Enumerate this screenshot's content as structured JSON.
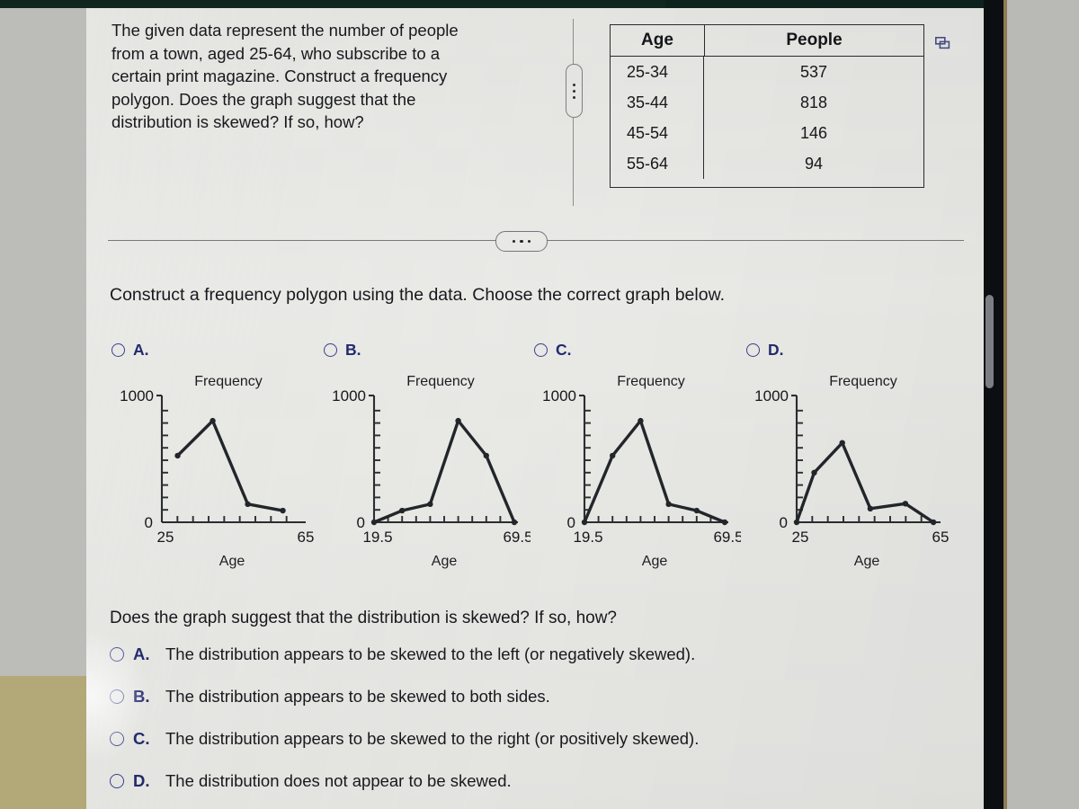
{
  "nav": {
    "back_icon": "back-to-start-icon",
    "copy_icon": "copy-icon",
    "divider_handle_icon": "vertical-more-options-icon",
    "section_expand_icon": "horizontal-more-options-icon"
  },
  "problem": {
    "statement": "The given data represent the number of people from a town, aged 25-64, who subscribe to a certain print magazine. Construct a frequency polygon. Does the graph suggest that the distribution is skewed? If so, how?"
  },
  "table": {
    "headers": [
      "Age",
      "People"
    ],
    "rows": [
      {
        "age": "25-34",
        "people": "537"
      },
      {
        "age": "35-44",
        "people": "818"
      },
      {
        "age": "45-54",
        "people": "146"
      },
      {
        "age": "55-64",
        "people": "94"
      }
    ]
  },
  "instruction": "Construct a frequency polygon using the data. Choose the correct graph below.",
  "graph_options": [
    {
      "letter": "A.",
      "selected": false
    },
    {
      "letter": "B.",
      "selected": false
    },
    {
      "letter": "C.",
      "selected": false
    },
    {
      "letter": "D.",
      "selected": false
    }
  ],
  "question2": {
    "prompt": "Does the graph suggest that the distribution is skewed? If so, how?",
    "options": [
      {
        "letter": "A.",
        "text": "The distribution appears to be skewed to the left (or negatively skewed).",
        "selected": false
      },
      {
        "letter": "B.",
        "text": "The distribution appears to be skewed to both sides.",
        "selected": false
      },
      {
        "letter": "C.",
        "text": "The distribution appears to be skewed to the right (or positively skewed).",
        "selected": false
      },
      {
        "letter": "D.",
        "text": "The distribution does not appear to be skewed.",
        "selected": false
      }
    ]
  },
  "colors": {
    "page_background": "#e9e9e6",
    "text": "#17191c",
    "radio_blue": "#3b4090",
    "letter_blue": "#222a6e",
    "plot_line": "#22262a",
    "axis": "#2a2e31"
  },
  "chart_data": [
    {
      "id": "A",
      "type": "line",
      "title": "",
      "xlabel": "Age",
      "ylabel": "Frequency",
      "ylim": [
        0,
        1000
      ],
      "ytick_labels": [
        "0",
        "1000"
      ],
      "xlim": [
        25,
        65
      ],
      "xtick_labels": [
        "25",
        "65"
      ],
      "x_minor_ticks": 8,
      "y_minor_ticks": 9,
      "grid": false,
      "x": [
        29.5,
        39.5,
        49.5,
        59.5
      ],
      "values": [
        537,
        818,
        146,
        94
      ]
    },
    {
      "id": "B",
      "type": "line",
      "title": "",
      "xlabel": "Age",
      "ylabel": "Frequency",
      "ylim": [
        0,
        1000
      ],
      "ytick_labels": [
        "0",
        "1000"
      ],
      "xlim": [
        19.5,
        69.5
      ],
      "xtick_labels": [
        "19.5",
        "69.5"
      ],
      "x_minor_ticks": 9,
      "y_minor_ticks": 9,
      "grid": false,
      "x": [
        19.5,
        29.5,
        39.5,
        49.5,
        59.5,
        69.5
      ],
      "values": [
        0,
        94,
        146,
        818,
        537,
        0
      ]
    },
    {
      "id": "C",
      "type": "line",
      "title": "",
      "xlabel": "Age",
      "ylabel": "Frequency",
      "ylim": [
        0,
        1000
      ],
      "ytick_labels": [
        "0",
        "1000"
      ],
      "xlim": [
        19.5,
        69.5
      ],
      "xtick_labels": [
        "19.5",
        "69.5"
      ],
      "x_minor_ticks": 9,
      "y_minor_ticks": 9,
      "grid": false,
      "x": [
        19.5,
        29.5,
        39.5,
        49.5,
        59.5,
        69.5
      ],
      "values": [
        0,
        537,
        818,
        146,
        94,
        0
      ]
    },
    {
      "id": "D",
      "type": "line",
      "title": "",
      "xlabel": "Age",
      "ylabel": "Frequency",
      "ylim": [
        0,
        1000
      ],
      "ytick_labels": [
        "0",
        "1000"
      ],
      "xlim": [
        25,
        65
      ],
      "xtick_labels": [
        "25",
        "65"
      ],
      "x_minor_ticks": 8,
      "y_minor_ticks": 9,
      "grid": false,
      "x": [
        25,
        30,
        38,
        46,
        56,
        64
      ],
      "values": [
        0,
        400,
        640,
        110,
        150,
        0
      ]
    }
  ]
}
